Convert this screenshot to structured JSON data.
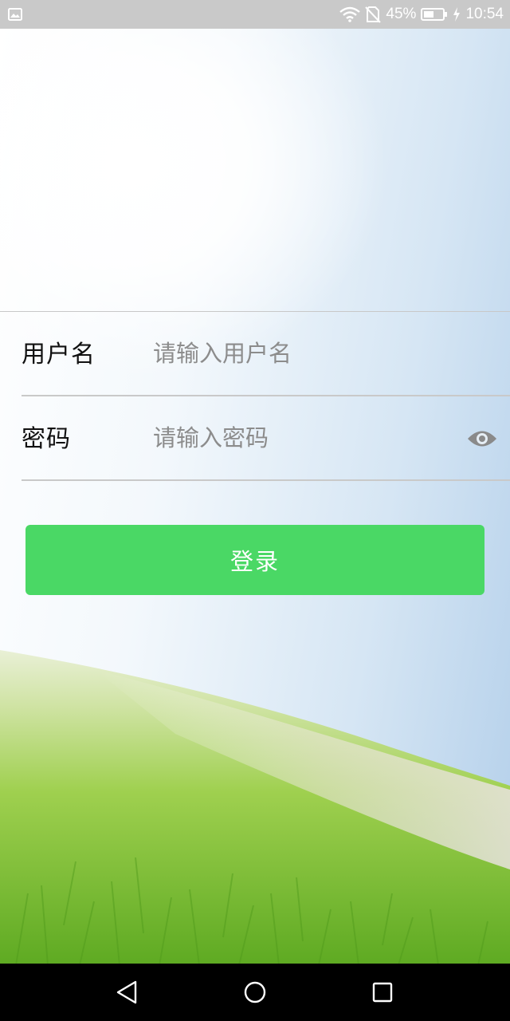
{
  "status_bar": {
    "battery_percent": "45%",
    "time": "10:54",
    "icons": [
      "gallery-notification-icon",
      "wifi-icon",
      "no-sim-icon",
      "battery-icon",
      "charging-bolt-icon"
    ]
  },
  "login_form": {
    "username": {
      "label": "用户名",
      "placeholder": "请输入用户名",
      "value": ""
    },
    "password": {
      "label": "密码",
      "placeholder": "请输入密码",
      "value": "",
      "toggle_icon": "eye-icon"
    },
    "submit_label": "登录"
  },
  "colors": {
    "status_bar_bg": "#c9c9c9",
    "button_green": "#4ad865",
    "nav_bar_bg": "#000000"
  },
  "nav_bar": {
    "icons": [
      "back-triangle-icon",
      "home-circle-icon",
      "recent-square-icon"
    ]
  }
}
